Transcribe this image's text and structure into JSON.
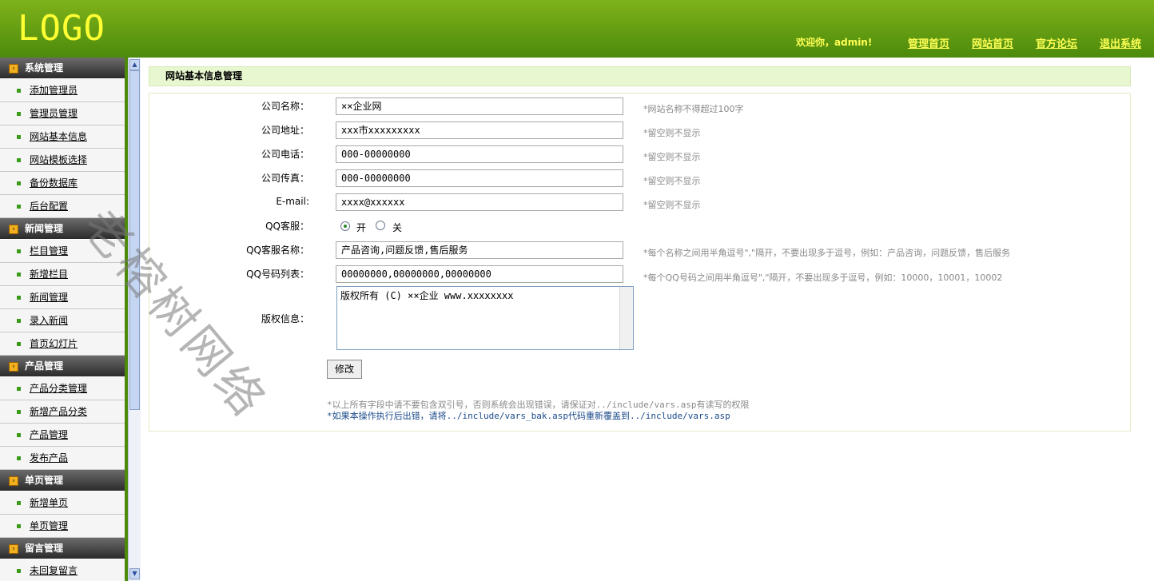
{
  "header": {
    "logo": "LOGO",
    "welcome": "欢迎你，admin!",
    "links": [
      "管理首页",
      "网站首页",
      "官方论坛",
      "退出系统"
    ]
  },
  "sidebar": {
    "sections": [
      {
        "title": "系统管理",
        "items": [
          "添加管理员",
          "管理员管理",
          "网站基本信息",
          "网站模板选择",
          "备份数据库",
          "后台配置"
        ]
      },
      {
        "title": "新闻管理",
        "items": [
          "栏目管理",
          "新增栏目",
          "新闻管理",
          "录入新闻",
          "首页幻灯片"
        ]
      },
      {
        "title": "产品管理",
        "items": [
          "产品分类管理",
          "新增产品分类",
          "产品管理",
          "发布产品"
        ]
      },
      {
        "title": "单页管理",
        "items": [
          "新增单页",
          "单页管理"
        ]
      },
      {
        "title": "留言管理",
        "items": [
          "未回复留言"
        ]
      }
    ]
  },
  "page": {
    "title": "网站基本信息管理"
  },
  "form": {
    "company_name": {
      "label": "公司名称：",
      "value": "××企业网",
      "hint": "*网站名称不得超过100字"
    },
    "company_address": {
      "label": "公司地址：",
      "value": "xxx市xxxxxxxxx",
      "hint": "*留空则不显示"
    },
    "company_phone": {
      "label": "公司电话：",
      "value": "000-00000000",
      "hint": "*留空则不显示"
    },
    "company_fax": {
      "label": "公司传真：",
      "value": "000-00000000",
      "hint": "*留空则不显示"
    },
    "email": {
      "label": "E-mail:",
      "value": "xxxx@xxxxxx",
      "hint": "*留空则不显示"
    },
    "qq_service": {
      "label": "QQ客服：",
      "on_label": "开",
      "off_label": "关",
      "selected": "on"
    },
    "qq_names": {
      "label": "QQ客服名称：",
      "value": "产品咨询,问题反馈,售后服务",
      "hint": "*每个名称之间用半角逗号\",\"隔开，不要出现多于逗号，例如：产品咨询，问题反馈，售后服务"
    },
    "qq_numbers": {
      "label": "QQ号码列表：",
      "value": "00000000,00000000,00000000",
      "hint": "*每个QQ号码之间用半角逗号\",\"隔开，不要出现多于逗号，例如：10000，10001，10002"
    },
    "copyright": {
      "label": "版权信息：",
      "value": "版权所有 (C) ××企业 www.xxxxxxxx"
    },
    "submit_label": "修改",
    "note1": "*以上所有字段中请不要包含双引号，否则系统会出现错误，请保证对../include/vars.asp有读写的权限",
    "note2": "*如果本操作执行后出错，请将../include/vars_bak.asp代码重新覆盖到../include/vars.asp"
  },
  "watermark": "老榕树网络"
}
